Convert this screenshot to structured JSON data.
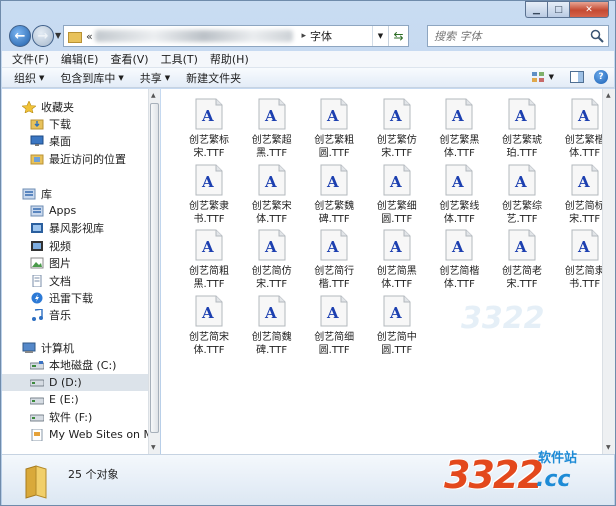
{
  "address": {
    "current": "字体"
  },
  "search": {
    "placeholder": "搜索 字体"
  },
  "menu": [
    {
      "label": "文件(F)"
    },
    {
      "label": "编辑(E)"
    },
    {
      "label": "查看(V)"
    },
    {
      "label": "工具(T)"
    },
    {
      "label": "帮助(H)"
    }
  ],
  "commands": [
    {
      "label": "组织",
      "dropdown": true
    },
    {
      "label": "包含到库中",
      "dropdown": true
    },
    {
      "label": "共享",
      "dropdown": true
    },
    {
      "label": "新建文件夹",
      "dropdown": false
    }
  ],
  "nav": {
    "favorites": {
      "label": "收藏夹",
      "items": [
        {
          "label": "下载",
          "icon": "download-folder-icon"
        },
        {
          "label": "桌面",
          "icon": "desktop-icon"
        },
        {
          "label": "最近访问的位置",
          "icon": "recent-places-icon"
        }
      ]
    },
    "libraries": {
      "label": "库",
      "items": [
        {
          "label": "Apps",
          "icon": "library-icon"
        },
        {
          "label": "暴风影视库",
          "icon": "video-library-icon"
        },
        {
          "label": "视频",
          "icon": "video-icon"
        },
        {
          "label": "图片",
          "icon": "pictures-icon"
        },
        {
          "label": "文档",
          "icon": "documents-icon"
        },
        {
          "label": "迅雷下载",
          "icon": "thunder-download-icon"
        },
        {
          "label": "音乐",
          "icon": "music-icon"
        }
      ]
    },
    "computer": {
      "label": "计算机",
      "items": [
        {
          "label": "本地磁盘 (C:)",
          "icon": "system-drive-icon",
          "selected": false
        },
        {
          "label": "D (D:)",
          "icon": "drive-icon",
          "selected": true
        },
        {
          "label": "E (E:)",
          "icon": "drive-icon",
          "selected": false
        },
        {
          "label": "软件 (F:)",
          "icon": "drive-icon",
          "selected": false
        },
        {
          "label": "My Web Sites on MSN",
          "icon": "web-sites-icon",
          "selected": false
        }
      ]
    }
  },
  "files": [
    {
      "line1": "创艺繁标",
      "line2": "宋.TTF"
    },
    {
      "line1": "创艺繁超",
      "line2": "黑.TTF"
    },
    {
      "line1": "创艺繁粗",
      "line2": "圆.TTF"
    },
    {
      "line1": "创艺繁仿",
      "line2": "宋.TTF"
    },
    {
      "line1": "创艺繁黑",
      "line2": "体.TTF"
    },
    {
      "line1": "创艺繁琥",
      "line2": "珀.TTF"
    },
    {
      "line1": "创艺繁楷",
      "line2": "体.TTF"
    },
    {
      "line1": "创艺繁隶",
      "line2": "书.TTF"
    },
    {
      "line1": "创艺繁宋",
      "line2": "体.TTF"
    },
    {
      "line1": "创艺繁魏",
      "line2": "碑.TTF"
    },
    {
      "line1": "创艺繁细",
      "line2": "圆.TTF"
    },
    {
      "line1": "创艺繁线",
      "line2": "体.TTF"
    },
    {
      "line1": "创艺繁综",
      "line2": "艺.TTF"
    },
    {
      "line1": "创艺简标",
      "line2": "宋.TTF"
    },
    {
      "line1": "创艺简粗",
      "line2": "黑.TTF"
    },
    {
      "line1": "创艺简仿",
      "line2": "宋.TTF"
    },
    {
      "line1": "创艺简行",
      "line2": "楷.TTF"
    },
    {
      "line1": "创艺简黑",
      "line2": "体.TTF"
    },
    {
      "line1": "创艺简楷",
      "line2": "体.TTF"
    },
    {
      "line1": "创艺简老",
      "line2": "宋.TTF"
    },
    {
      "line1": "创艺简隶",
      "line2": "书.TTF"
    },
    {
      "line1": "创艺简宋",
      "line2": "体.TTF"
    },
    {
      "line1": "创艺简魏",
      "line2": "碑.TTF"
    },
    {
      "line1": "创艺简细",
      "line2": "圆.TTF"
    },
    {
      "line1": "创艺简中",
      "line2": "圆.TTF"
    }
  ],
  "file_icon": "font-file-icon",
  "status": {
    "count": "25 个对象"
  },
  "watermark": {
    "number": "3322",
    "sub": "软件站",
    "domain": ".cc"
  },
  "colors": {
    "accent": "#1d8bd6",
    "logo_red": "#e3481c",
    "selection": "#dce3ea",
    "font_glyph": "#1c3fb0"
  }
}
